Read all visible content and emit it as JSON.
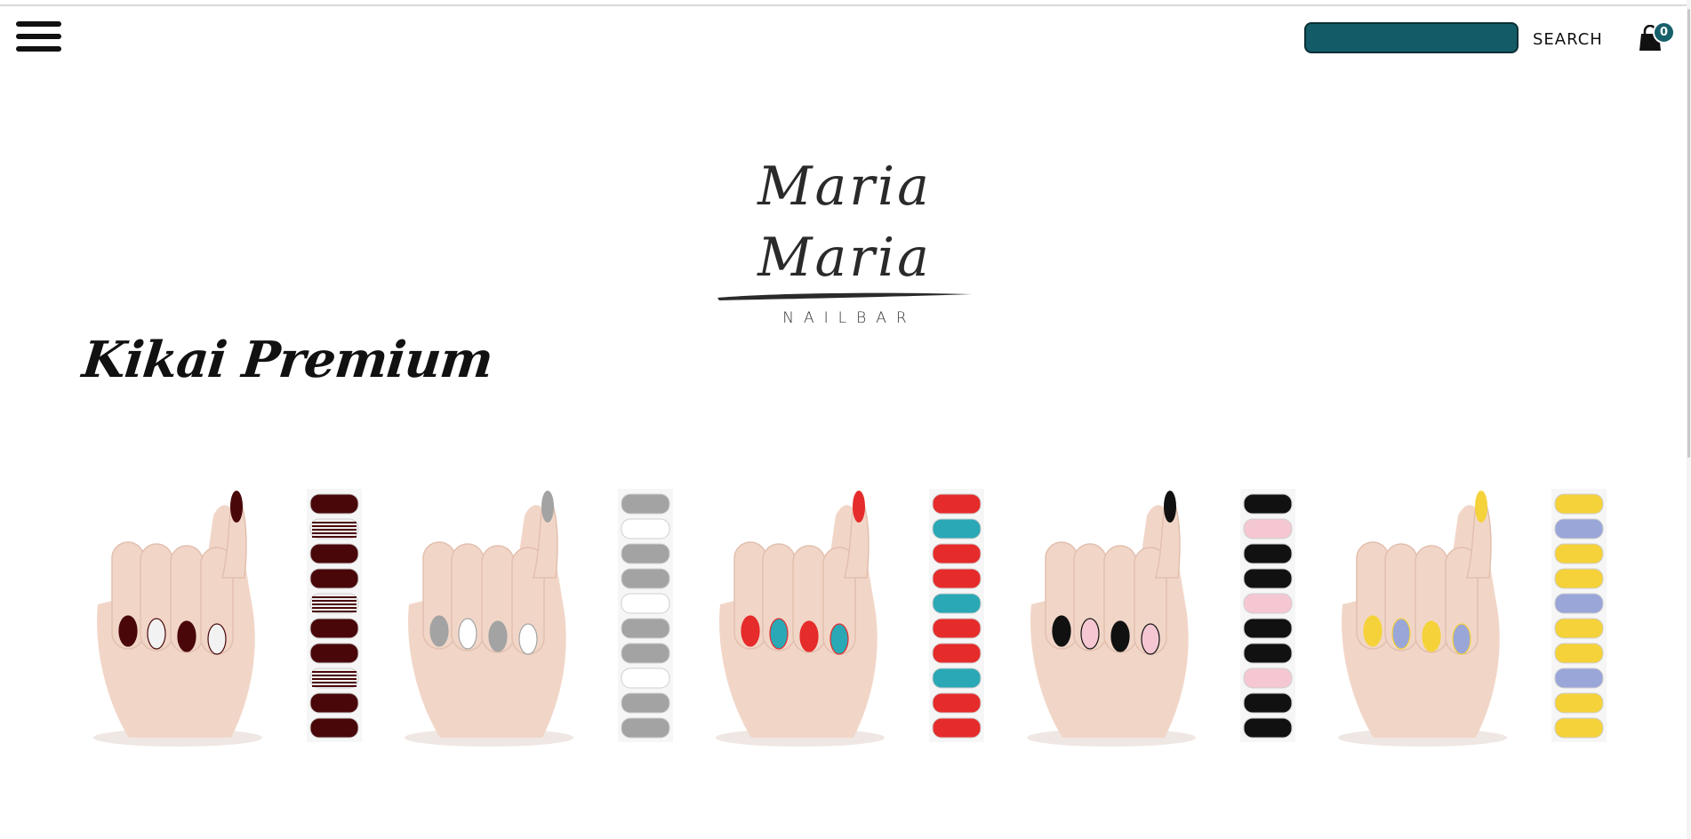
{
  "header": {
    "search": {
      "value": "",
      "placeholder": "",
      "button_label": "SEARCH",
      "field_color": "#135c67"
    },
    "cart": {
      "count": "0",
      "icon": "shopping-bag-icon",
      "badge_color": "#17606b"
    },
    "menu_icon": "hamburger-menu-icon"
  },
  "logo": {
    "script": "Maria Maria",
    "subtitle": "NAILBAR"
  },
  "page": {
    "title": "Kikai Premium"
  },
  "products": [
    {
      "polish": "#4a0709",
      "accent": "#f2f2f2",
      "pattern": "stripes"
    },
    {
      "polish": "#a3a3a3",
      "accent": "#ffffff",
      "pattern": "grey"
    },
    {
      "polish": "#e62b2b",
      "accent": "#2aa8b5",
      "pattern": "tribal"
    },
    {
      "polish": "#111111",
      "accent": "#f4c7d2",
      "pattern": "chevron"
    },
    {
      "polish": "#f5d23a",
      "accent": "#9aa6d8",
      "pattern": "gradient"
    }
  ]
}
